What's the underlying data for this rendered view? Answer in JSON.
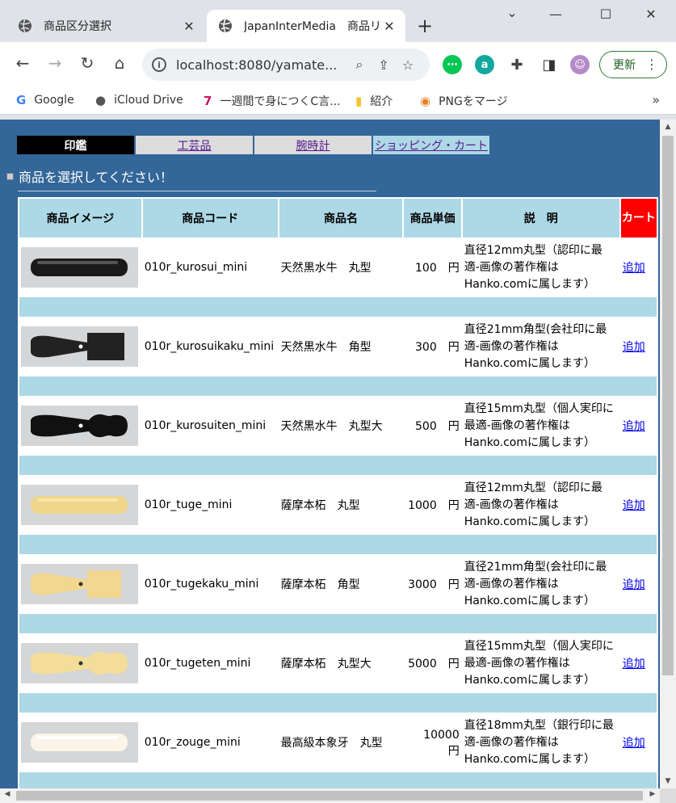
{
  "browser": {
    "tabs": [
      {
        "title": "商品区分選択",
        "active": false
      },
      {
        "title": "JapanInterMedia　商品リスト",
        "active": true
      }
    ],
    "url": "localhost:8080/yamate...",
    "update_label": "更新",
    "bookmarks": [
      "Google",
      "iCloud Drive",
      "一週間で身につくC言...",
      "紹介",
      "PNGをマージ"
    ]
  },
  "page": {
    "menu": [
      {
        "label": "印鑑",
        "selected": true
      },
      {
        "label": "工芸品",
        "selected": false
      },
      {
        "label": "腕時計",
        "selected": false
      },
      {
        "label": "ショッピング・カート",
        "selected": false
      }
    ],
    "heading": "商品を選択してください！",
    "columns": [
      "商品イメージ",
      "商品コード",
      "商品名",
      "商品単価",
      "説　明",
      "カート"
    ],
    "currency_suffix": "円",
    "add_label": "追加",
    "colors": {
      "background": "#336699",
      "header": "#add8e6",
      "cart_header": "#ff0000",
      "selected_menu": "#000000"
    },
    "items": [
      {
        "code": "010r_kurosui_mini",
        "name": "天然黒水牛　丸型",
        "price": "100",
        "desc": [
          "直径12mm丸型（認印に最",
          "適-画像の著作権は",
          "Hanko.comに属します）"
        ],
        "image": "black-round-seal"
      },
      {
        "code": "010r_kurosuikaku_mini",
        "name": "天然黒水牛　角型",
        "price": "300",
        "desc": [
          "直径21mm角型(会社印に最",
          "適-画像の著作権は",
          "Hanko.comに属します）"
        ],
        "image": "black-square-seal"
      },
      {
        "code": "010r_kurosuiten_mini",
        "name": "天然黒水牛　丸型大",
        "price": "500",
        "desc": [
          "直径15mm丸型（個人実印に",
          "最適-画像の著作権は",
          "Hanko.comに属します）"
        ],
        "image": "black-tenbori-seal"
      },
      {
        "code": "010r_tuge_mini",
        "name": "薩摩本柘　丸型",
        "price": "1000",
        "desc": [
          "直径12mm丸型（認印に最",
          "適-画像の著作権は",
          "Hanko.comに属します）"
        ],
        "image": "boxwood-round-seal"
      },
      {
        "code": "010r_tugekaku_mini",
        "name": "薩摩本柘　角型",
        "price": "3000",
        "desc": [
          "直径21mm角型(会社印に最",
          "適-画像の著作権は",
          "Hanko.comに属します）"
        ],
        "image": "boxwood-square-seal"
      },
      {
        "code": "010r_tugeten_mini",
        "name": "薩摩本柘　丸型大",
        "price": "5000",
        "desc": [
          "直径15mm丸型（個人実印に",
          "最適-画像の著作権は",
          "Hanko.comに属します）"
        ],
        "image": "boxwood-tenbori-seal"
      },
      {
        "code": "010r_zouge_mini",
        "name": "最高級本象牙　丸型",
        "price": "10000",
        "desc": [
          "直径18mm丸型（銀行印に最",
          "適-画像の著作権は",
          "Hanko.comに属します）"
        ],
        "image": "ivory-round-seal"
      }
    ]
  }
}
